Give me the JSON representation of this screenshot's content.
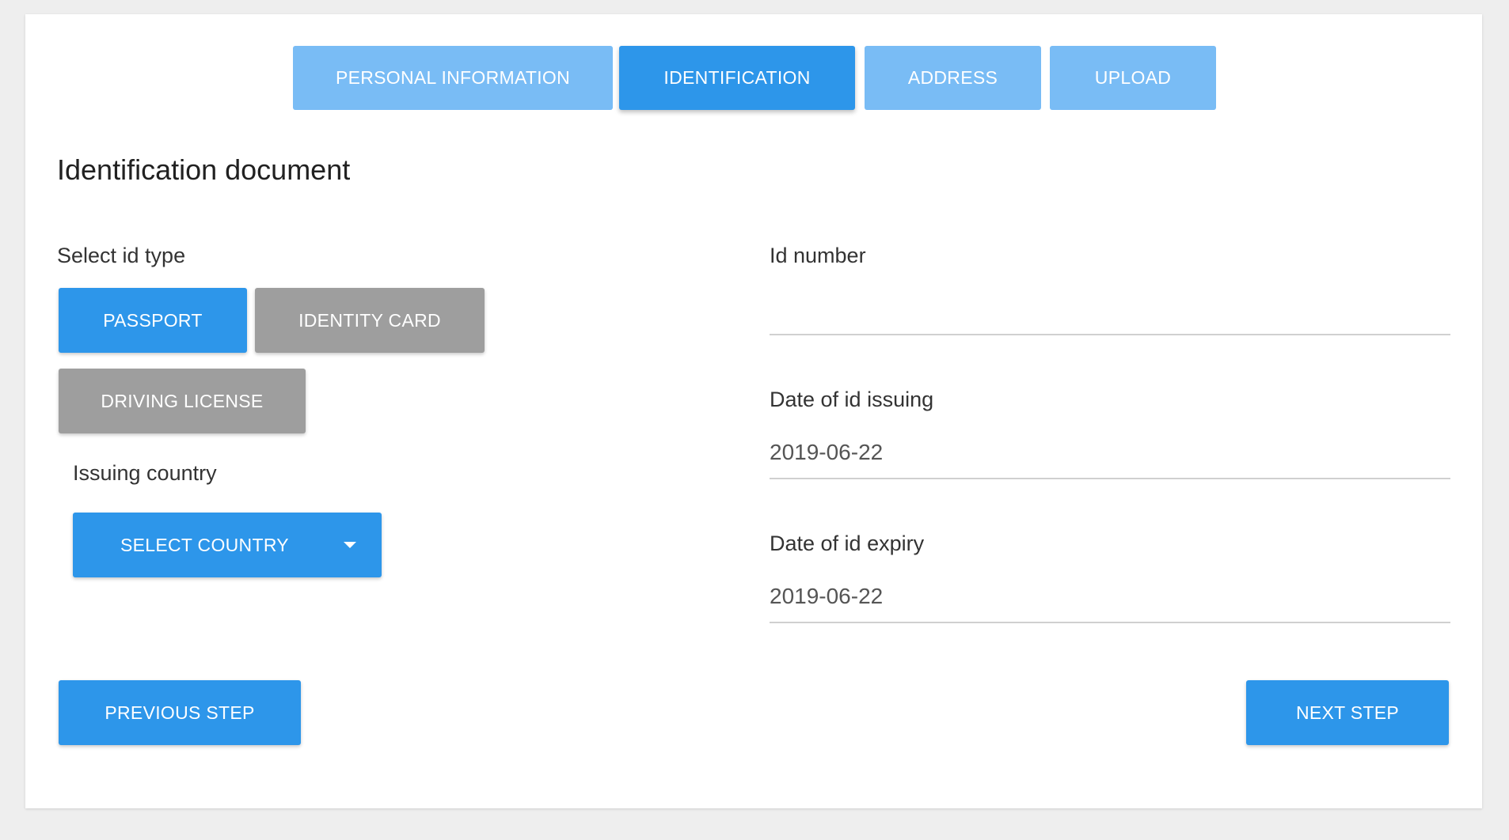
{
  "steps": [
    {
      "label": "PERSONAL INFORMATION",
      "active": false
    },
    {
      "label": "IDENTIFICATION",
      "active": true
    },
    {
      "label": "ADDRESS",
      "active": false
    },
    {
      "label": "UPLOAD",
      "active": false
    }
  ],
  "section_title": "Identification document",
  "id_type": {
    "label": "Select id type",
    "options": [
      "PASSPORT",
      "IDENTITY CARD",
      "DRIVING LICENSE"
    ],
    "selected": "PASSPORT"
  },
  "issuing_country": {
    "label": "Issuing country",
    "button_label": "SELECT COUNTRY"
  },
  "id_number": {
    "label": "Id number",
    "value": ""
  },
  "date_issuing": {
    "label": "Date of id issuing",
    "value": "2019-06-22"
  },
  "date_expiry": {
    "label": "Date of id expiry",
    "value": "2019-06-22"
  },
  "navigation": {
    "previous_label": "PREVIOUS STEP",
    "next_label": "NEXT STEP"
  },
  "colors": {
    "primary": "#2d96ea",
    "tab_inactive": "#79bcf5",
    "unselected": "#9e9e9e"
  }
}
